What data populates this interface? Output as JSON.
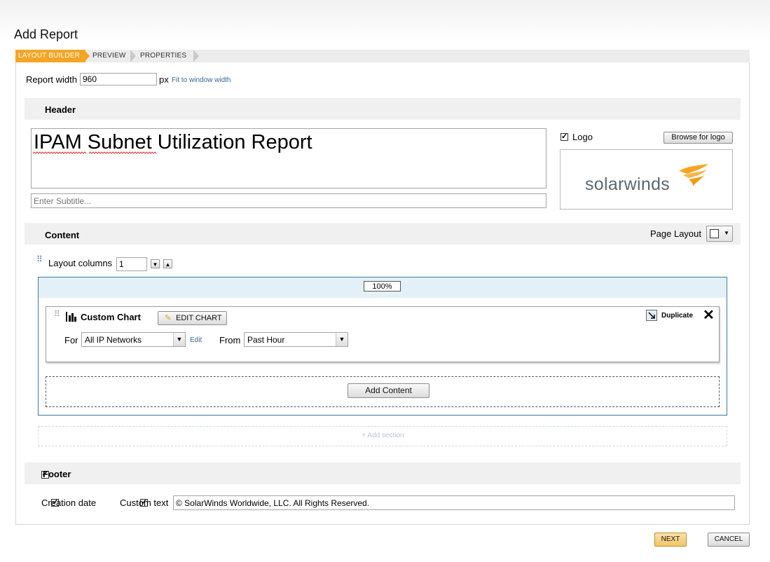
{
  "page": {
    "title": "Add Report"
  },
  "wizard": {
    "tabs": [
      "LAYOUT BUILDER",
      "PREVIEW",
      "PROPERTIES"
    ],
    "active_tab": "LAYOUT BUILDER"
  },
  "report_width": {
    "label": "Report width",
    "value": "960",
    "unit": "px",
    "fit_link": "Fit to window width"
  },
  "header_section": {
    "title": "Header",
    "report_title": "IPAM Subnet Utilization Report",
    "subtitle_placeholder": "Enter Subtitle...",
    "logo_label": "Logo",
    "logo_checked": true,
    "browse_label": "Browse for logo",
    "logo_text": "solarwinds"
  },
  "content_section": {
    "title": "Content",
    "page_layout_label": "Page Layout",
    "layout_columns_label": "Layout columns",
    "layout_columns_value": "1",
    "column_width": "100%",
    "resource": {
      "title": "Custom Chart",
      "edit_chart_label": "EDIT CHART",
      "duplicate_label": "Duplicate",
      "for_label": "For",
      "for_value": "All IP Networks",
      "edit_link": "Edit",
      "from_label": "From",
      "from_value": "Past Hour"
    },
    "add_content_label": "Add Content",
    "add_section_label": "+ Add section"
  },
  "footer_section": {
    "title": "Footer",
    "footer_checked": true,
    "creation_date_label": "Creation date",
    "creation_date_checked": true,
    "custom_text_label": "Custom text",
    "custom_text_checked": true,
    "custom_text_value": "© SolarWinds Worldwide, LLC. All Rights Reserved."
  },
  "actions": {
    "next_label": "NEXT",
    "cancel_label": "CANCEL"
  },
  "colors": {
    "accent": "#f5a524",
    "link": "#336699",
    "column_border": "#3a7aa0",
    "column_header_bg": "#e3f0f8"
  }
}
